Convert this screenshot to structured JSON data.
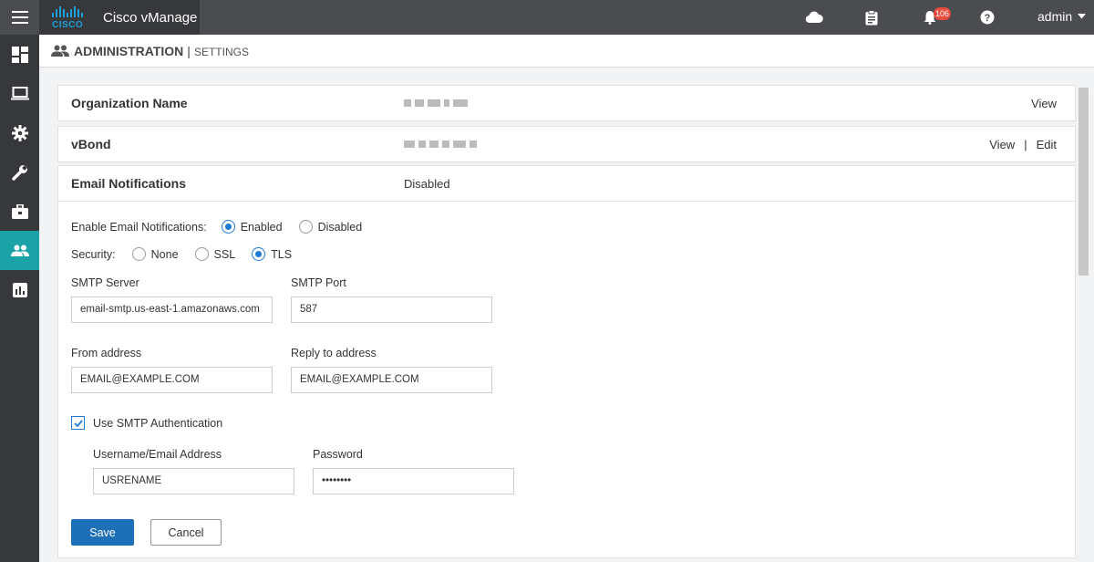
{
  "topbar": {
    "app_title": "Cisco vManage",
    "logo_text": "CISCO",
    "notification_count": "106",
    "user": "admin"
  },
  "page": {
    "title": "ADMINISTRATION",
    "separator": "|",
    "subtitle": "SETTINGS"
  },
  "org": {
    "label": "Organization Name",
    "action_view": "View"
  },
  "vbond": {
    "label": "vBond",
    "action_view": "View",
    "action_sep": "|",
    "action_edit": "Edit"
  },
  "email": {
    "label": "Email Notifications",
    "status": "Disabled",
    "enable_label": "Enable Email Notifications:",
    "enable_options": [
      "Enabled",
      "Disabled"
    ],
    "enable_selected": "Enabled",
    "security_label": "Security:",
    "security_options": [
      "None",
      "SSL",
      "TLS"
    ],
    "security_selected": "TLS",
    "smtp_server_label": "SMTP Server",
    "smtp_server_value": "email-smtp.us-east-1.amazonaws.com",
    "smtp_port_label": "SMTP Port",
    "smtp_port_value": "587",
    "from_label": "From address",
    "from_value": "EMAIL@EXAMPLE.COM",
    "reply_label": "Reply to address",
    "reply_value": "EMAIL@EXAMPLE.COM",
    "smtp_auth_label": "Use SMTP Authentication",
    "smtp_auth_checked": true,
    "username_label": "Username/Email Address",
    "username_value": "USRENAME",
    "password_label": "Password",
    "password_value": "••••••••",
    "save_label": "Save",
    "cancel_label": "Cancel"
  },
  "colors": {
    "accent": "#1d7bd6",
    "sidebar_active": "#1aa2a6",
    "save_button": "#1d6fb8",
    "badge": "#e74c3c"
  }
}
